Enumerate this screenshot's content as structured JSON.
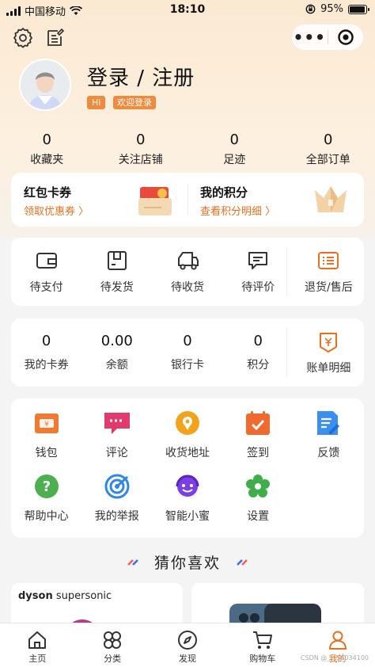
{
  "status_bar": {
    "carrier": "中国移动",
    "time": "18:10",
    "battery": "95%"
  },
  "toolbar": {
    "settings_icon": "gear-icon",
    "message_icon": "note-icon",
    "capsule_more": "•••",
    "capsule_close_icon": "target-icon"
  },
  "profile": {
    "title": "登录 / 注册",
    "tag_hi": "Hi",
    "tag_welcome": "欢迎登录"
  },
  "stats": [
    {
      "value": "0",
      "label": "收藏夹"
    },
    {
      "value": "0",
      "label": "关注店铺"
    },
    {
      "value": "0",
      "label": "足迹"
    },
    {
      "value": "0",
      "label": "全部订单"
    }
  ],
  "promo": {
    "left": {
      "title": "红包卡券",
      "subtitle": "领取优惠券 〉"
    },
    "right": {
      "title": "我的积分",
      "subtitle": "查看积分明细 〉"
    }
  },
  "orders": [
    {
      "label": "待支付",
      "icon": "wallet-icon"
    },
    {
      "label": "待发货",
      "icon": "box-icon"
    },
    {
      "label": "待收货",
      "icon": "truck-icon"
    },
    {
      "label": "待评价",
      "icon": "chat-icon"
    },
    {
      "label": "退货/售后",
      "icon": "return-icon"
    }
  ],
  "wallet": [
    {
      "value": "0",
      "label": "我的卡券"
    },
    {
      "value": "0.00",
      "label": "余额"
    },
    {
      "value": "0",
      "label": "银行卡"
    },
    {
      "value": "0",
      "label": "积分"
    },
    {
      "value": "",
      "label": "账单明细",
      "icon": "bill-icon"
    }
  ],
  "services": [
    {
      "label": "钱包",
      "icon": "wallet-icon",
      "color": "#f07a2f"
    },
    {
      "label": "评论",
      "icon": "comment-icon",
      "color": "#e23a6d"
    },
    {
      "label": "收货地址",
      "icon": "location-icon",
      "color": "#f2a31b"
    },
    {
      "label": "签到",
      "icon": "calendar-icon",
      "color": "#f06a2f"
    },
    {
      "label": "反馈",
      "icon": "feedback-icon",
      "color": "#3b8ff0"
    },
    {
      "label": "帮助中心",
      "icon": "help-icon",
      "color": "#4caf50"
    },
    {
      "label": "我的举报",
      "icon": "report-icon",
      "color": "#2f87e8"
    },
    {
      "label": "智能小蜜",
      "icon": "assistant-icon",
      "color": "#7b3fe4"
    },
    {
      "label": "设置",
      "icon": "settings-icon",
      "color": "#3fae4a"
    }
  ],
  "guess": {
    "title": "猜你喜欢"
  },
  "products": [
    {
      "brand": "dyson",
      "model": "supersonic"
    },
    {
      "brand": "",
      "model": ""
    }
  ],
  "tabbar": [
    {
      "label": "主页",
      "icon": "home-icon"
    },
    {
      "label": "分类",
      "icon": "category-icon"
    },
    {
      "label": "发现",
      "icon": "compass-icon"
    },
    {
      "label": "购物车",
      "icon": "cart-icon"
    },
    {
      "label": "我的",
      "icon": "user-icon",
      "active": true
    }
  ],
  "watermark": "CSDN @___56034100",
  "colors": {
    "accent": "#e8701f",
    "tag": "#f08a3c"
  }
}
